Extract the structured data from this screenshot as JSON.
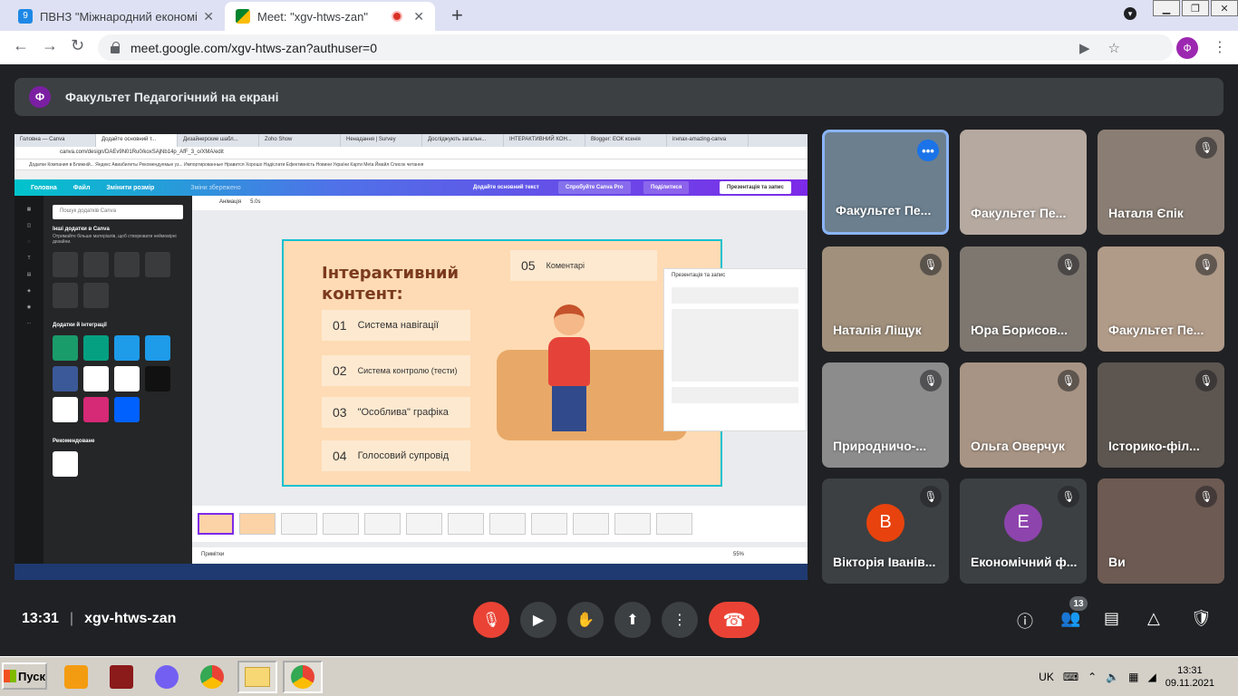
{
  "browser": {
    "tabs": [
      {
        "title": "ПВНЗ \"Міжнародний економіко",
        "active": false
      },
      {
        "title": "Meet: \"xgv-htws-zan\"",
        "active": true
      }
    ],
    "url": "meet.google.com/xgv-htws-zan?authuser=0",
    "profile_initial": "Ф"
  },
  "meet": {
    "presenter_initial": "Ф",
    "presenter_banner": "Факультет Педагогічний на екрані",
    "time": "13:31",
    "meeting_code": "xgv-htws-zan",
    "participant_count": "13",
    "participants": [
      {
        "name": "Факультет Пе...",
        "muted": false,
        "active": true
      },
      {
        "name": "Факультет Пе...",
        "muted": false,
        "active": false
      },
      {
        "name": "Наталя Єпік",
        "muted": true,
        "active": false
      },
      {
        "name": "Наталія Ліщук",
        "muted": true,
        "active": false
      },
      {
        "name": "Юра Борисов...",
        "muted": true,
        "active": false
      },
      {
        "name": "Факультет Пе...",
        "muted": true,
        "active": false
      },
      {
        "name": "Природничо-...",
        "muted": true,
        "active": false
      },
      {
        "name": "Ольга Оверчук",
        "muted": true,
        "active": false
      },
      {
        "name": "Історико-філ...",
        "muted": true,
        "active": false
      },
      {
        "name": "Вікторія Іванів...",
        "muted": true,
        "active": false,
        "initial": "В",
        "color": "#e8430e"
      },
      {
        "name": "Економічний ф...",
        "muted": true,
        "active": false,
        "initial": "Е",
        "color": "#8e44ad"
      },
      {
        "name": "Ви",
        "muted": true,
        "active": false
      }
    ]
  },
  "shared_screen": {
    "inner_tabs": [
      "Головна — Canva",
      "Додайте основний т...",
      "Дизайнерские шабл...",
      "Zoho Show",
      "Ненадання | Survey",
      "Досліджують загальн...",
      "ІНТЕРАКТИВНИЙ КОН...",
      "Blogger: ЕОК ксенія",
      "ігнпах-amazing-canva"
    ],
    "inner_url": "canva.com/design/DAEv9N01Ru0/koxSAjNb14p_AfF_3_o/XMA/edit",
    "bookmarks": "Додатки  Компания в Ближній...  Яндекс  Авиабилеты  Рекомендуемые уз...  Импортированные  Нравится  Хорошо  Надіслати  Ефективність  Новини України  Карти  Meta  Ймайл  Список читання",
    "canva_menu": {
      "home": "Головна",
      "file": "Файл",
      "resize": "Змінити розмір",
      "saved": "Зміни збережено",
      "add_text": "Додайте основний текст",
      "try_pro": "Спробуйте Canva Pro",
      "share": "Поділитися",
      "present": "Презентація та запис"
    },
    "search_placeholder": "Пошук додатків Canva",
    "more_apps_title": "Інші додатки в Canva",
    "more_apps_sub": "Отримайте більше матеріалів, щоб створювати неймовірні дизайни.",
    "integrations_title": "Додатки й інтеграції",
    "recommended_title": "Рекомендоване",
    "animation_label": "Анімація",
    "duration_label": "5.0s",
    "slide": {
      "title_line1": "Інтерактивний",
      "title_line2": "контент:",
      "items": [
        {
          "num": "01",
          "text": "Система навігації"
        },
        {
          "num": "02",
          "text": "Система контролю (тести)"
        },
        {
          "num": "03",
          "text": "\"Особлива\" графіка"
        },
        {
          "num": "04",
          "text": "Голосовий супровід"
        }
      ],
      "item5": {
        "num": "05",
        "text": "Коментарі"
      }
    },
    "present_panel_title": "Презентація та запис",
    "notes_label": "Примітки",
    "zoom": "55%"
  },
  "taskbar": {
    "start_label": "Пуск",
    "language": "UK",
    "time": "13:31",
    "date": "09.11.2021"
  }
}
